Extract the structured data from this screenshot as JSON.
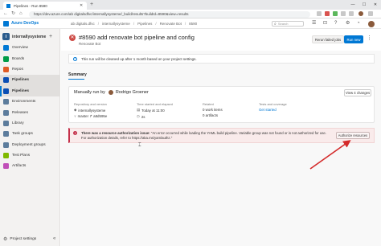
{
  "browser": {
    "tab_title": "Pipelines - Run 8590",
    "tab_close": "✕",
    "new_tab": "+",
    "url": "https://dev.azure.com/ab digitalsdfvc/internallysysteme/_build/results?buildId=8590&view=results",
    "win_minimize": "—",
    "win_maximize": "☐",
    "win_close": "✕"
  },
  "topbar": {
    "product": "Azure DevOps",
    "breadcrumbs": [
      "ab digitals.dfvc",
      "/",
      "internallysysteme",
      "/",
      "Pipelines",
      "/",
      "Renovate Bot",
      "/",
      "8590"
    ],
    "search_placeholder": "Search"
  },
  "sidebar": {
    "project_initial": "I",
    "project_name": "internallysysteme",
    "add": "+",
    "items": [
      {
        "label": "Overview",
        "icon_color": "#0078d4",
        "active": false,
        "selected": false
      },
      {
        "label": "Boards",
        "icon_color": "#009c47",
        "active": false,
        "selected": false
      },
      {
        "label": "Repos",
        "icon_color": "#e05b25",
        "active": false,
        "selected": false
      },
      {
        "label": "Pipelines",
        "icon_color": "#0a4eb4",
        "active": true,
        "selected": false
      },
      {
        "label": "Pipelines",
        "icon_color": "#0a4eb4",
        "active": true,
        "selected": true
      },
      {
        "label": "Environments",
        "icon_color": "#5c7c9c",
        "active": false,
        "selected": false
      },
      {
        "label": "Releases",
        "icon_color": "#5c7c9c",
        "active": false,
        "selected": false
      },
      {
        "label": "Library",
        "icon_color": "#5c7c9c",
        "active": false,
        "selected": false
      },
      {
        "label": "Task groups",
        "icon_color": "#5c7c9c",
        "active": false,
        "selected": false
      },
      {
        "label": "Deployment groups",
        "icon_color": "#5c7c9c",
        "active": false,
        "selected": false
      },
      {
        "label": "Test Plans",
        "icon_color": "#7fb900",
        "active": false,
        "selected": false
      },
      {
        "label": "Artifacts",
        "icon_color": "#c04fb8",
        "active": false,
        "selected": false
      }
    ],
    "footer_label": "Project settings",
    "collapse": "«"
  },
  "header": {
    "status_glyph": "✕",
    "title": "#8590 add renovate bot pipeline and config",
    "subtitle": "Renovate Bot",
    "rerun_label": "Rerun failed jobs",
    "run_label": "Run new",
    "more": "⋮"
  },
  "info_banner": {
    "glyph": "i",
    "text": "This run will be cleaned up after 1 month based on your project settings."
  },
  "summary_tab": "Summary",
  "run_card": {
    "manually_run_by": "Manually run by",
    "user": "Rodrigo Groener",
    "view_changes": "View 4 changes",
    "columns": [
      {
        "head": "Repository and version",
        "lines": [
          {
            "glyph": "◆",
            "text": "internallysysteme",
            "link": false
          },
          {
            "glyph": "ᛘ",
            "text": "master  ↱ a8d595e",
            "link": false
          }
        ]
      },
      {
        "head": "Time started and elapsed",
        "lines": [
          {
            "glyph": "▤",
            "text": "Today at 11:00",
            "link": false
          },
          {
            "glyph": "◷",
            "text": "2s",
            "link": false
          }
        ]
      },
      {
        "head": "Related",
        "lines": [
          {
            "glyph": "",
            "text": "0 work items",
            "link": false
          },
          {
            "glyph": "",
            "text": "0 artifacts",
            "link": false
          }
        ]
      },
      {
        "head": "Tests and coverage",
        "lines": [
          {
            "glyph": "",
            "text": "Get started",
            "link": true
          }
        ]
      }
    ]
  },
  "error_banner": {
    "glyph": "!",
    "title": "There was a resource authorization issue:",
    "text": " \"An error occurred while loading the YAML build pipeline. Variable group was not found or is not authorized for use. For authorization details, refer to https://aka.ms/yamlauthz.\"",
    "authorize_label": "Authorize resources"
  },
  "accent_colors": {
    "brand": "#0078d4",
    "error": "#c4314b",
    "arrow": "#d42a2a"
  }
}
